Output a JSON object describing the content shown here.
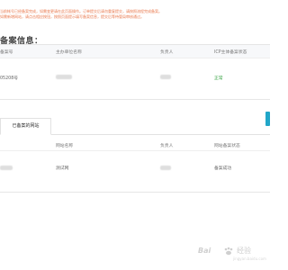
{
  "notice": {
    "line1": "当前帐号已经备案完成，如需变更请在此页面操作。订单提交后请勿重复提交，请按照流程完成备案。",
    "line2": "如需新增网站，请点击相应按钮，按照页面提示填写备案信息，提交后等待管局审核通过。"
  },
  "section": {
    "title": "备案信息："
  },
  "subject_table": {
    "headers": [
      "备案号",
      "主办单位名称",
      "负责人",
      "ICP主体备案状态"
    ],
    "row": {
      "id_suffix": "05208号",
      "status": "正常"
    }
  },
  "tabs": {
    "active": "已备案的网站"
  },
  "site_table": {
    "headers": [
      "网站名称",
      "负责人",
      "网站备案状态"
    ],
    "row": {
      "site_name": "测试网",
      "status": "备案成功"
    }
  },
  "watermark": {
    "brand_a": "Bai",
    "brand_b": "经验",
    "sub": "jingyan.baidu.com"
  },
  "colors": {
    "notice": "#e8764a",
    "status_ok": "#2e9e3a",
    "accent": "#21a6c8"
  }
}
